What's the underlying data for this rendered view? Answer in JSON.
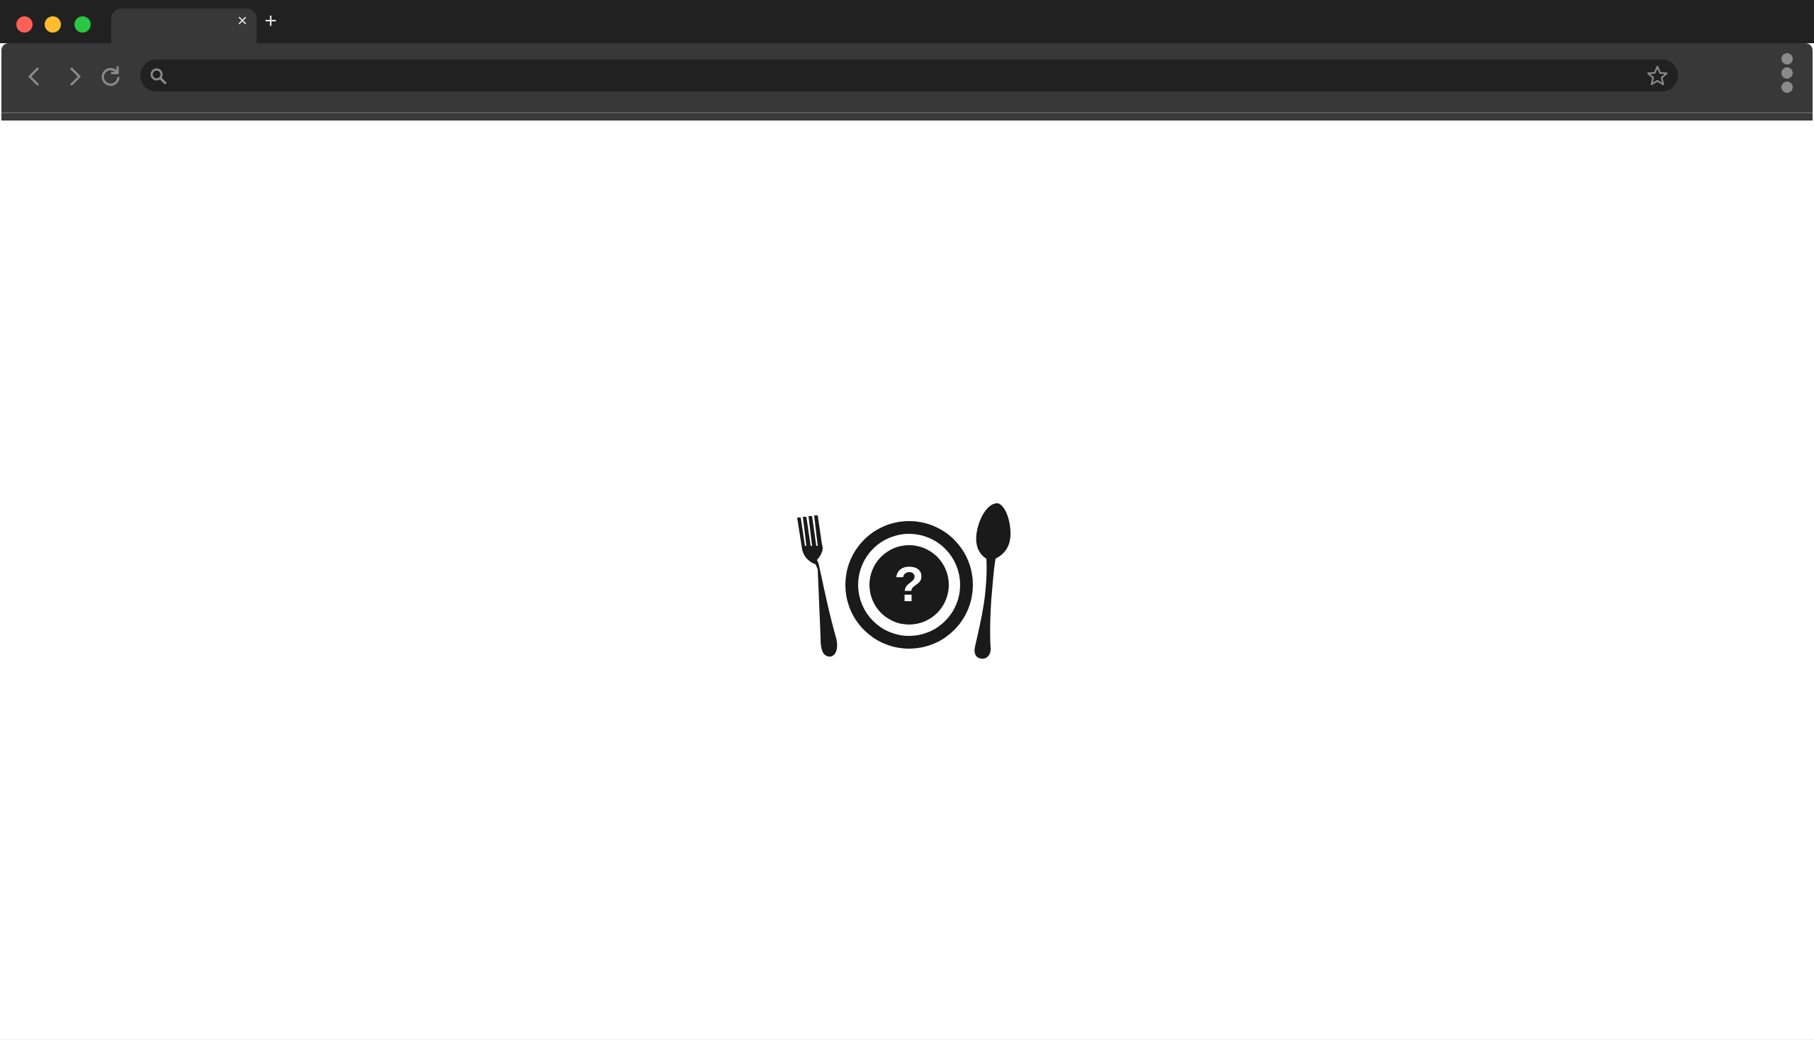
{
  "window": {
    "controls": [
      "close",
      "minimize",
      "maximize"
    ]
  },
  "tabs": [
    {
      "title": "",
      "close_icon": "close-icon"
    }
  ],
  "toolbar": {
    "back_icon": "chevron-left-icon",
    "forward_icon": "chevron-right-icon",
    "reload_icon": "reload-icon",
    "new_tab_icon": "plus-icon",
    "menu_icon": "kebab-menu-icon"
  },
  "address_bar": {
    "value": "",
    "placeholder": "",
    "search_icon": "search-icon",
    "bookmark_icon": "star-icon"
  },
  "content": {
    "illustration": "plate-with-fork-spoon-question-mark-icon",
    "question_mark": "?"
  },
  "colors": {
    "title_bar": "#212121",
    "toolbar": "#383838",
    "address_bar": "#212121",
    "close": "#ff5f57",
    "minimize": "#febc2e",
    "maximize": "#28c840",
    "icon_gray": "#8a8a8a",
    "illustration": "#1a1a1a",
    "page_bg": "#ffffff"
  }
}
